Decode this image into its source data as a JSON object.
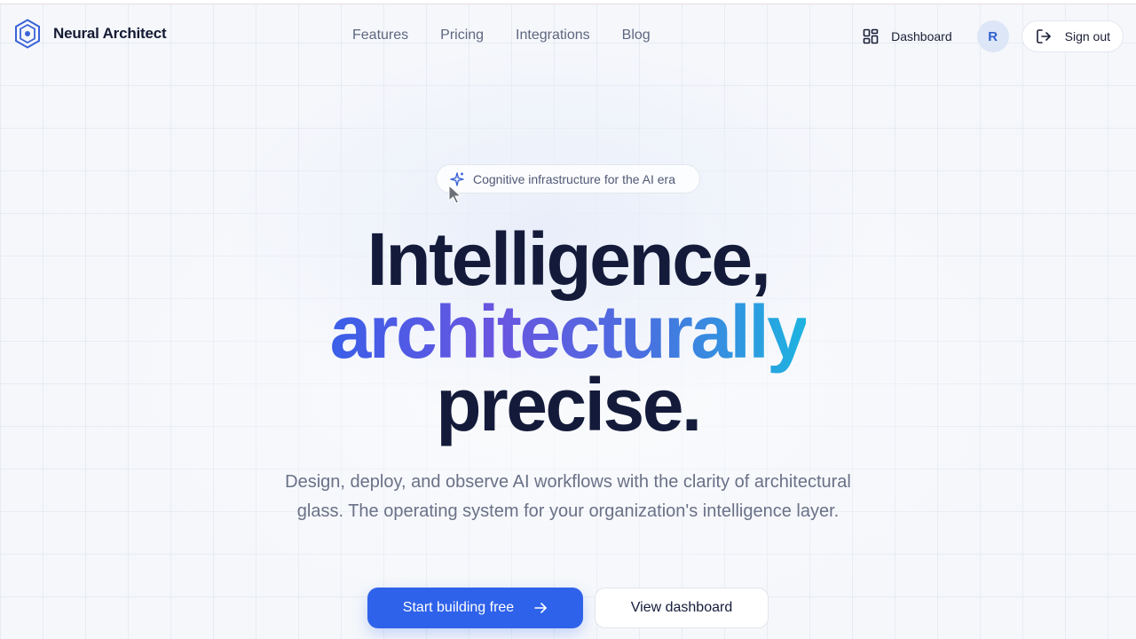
{
  "brand": {
    "name": "Neural Architect",
    "logo_icon": "hexagon-logo-icon"
  },
  "nav": {
    "items": [
      {
        "label": "Features"
      },
      {
        "label": "Pricing"
      },
      {
        "label": "Integrations"
      },
      {
        "label": "Blog"
      }
    ]
  },
  "header_actions": {
    "dashboard_label": "Dashboard",
    "dashboard_icon": "grid-icon",
    "avatar_initial": "R",
    "signout_label": "Sign out",
    "signout_icon": "logout-icon"
  },
  "hero": {
    "badge_text": "Cognitive infrastructure for the AI era",
    "badge_icon": "sparkle-icon",
    "headline_line1": "Intelligence,",
    "headline_line2": "architecturally",
    "headline_line3": "precise.",
    "subtitle": "Design, deploy, and observe AI workflows with the clarity of architectural glass. The operating system for your organization's intelligence layer.",
    "primary_cta": "Start building free",
    "primary_cta_icon": "arrow-right-icon",
    "secondary_cta": "View dashboard"
  },
  "colors": {
    "accent": "#2f62ea",
    "heading": "#141b3a",
    "gradient_start": "#3a5fe8",
    "gradient_end": "#1eb3e0",
    "muted_text": "#6a7187"
  }
}
